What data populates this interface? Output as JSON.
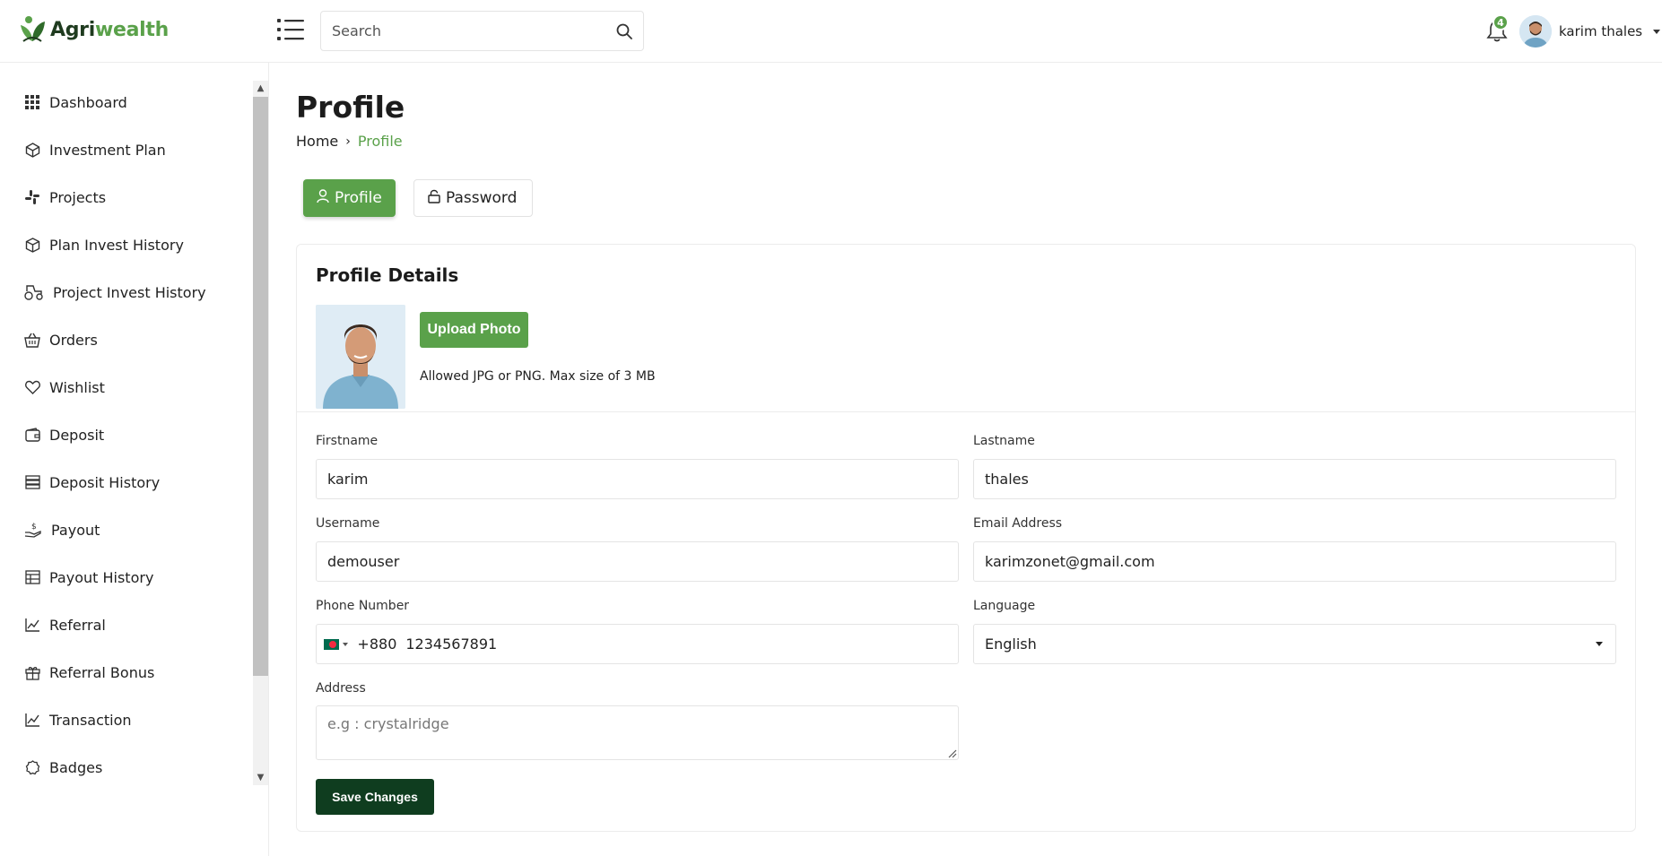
{
  "brand": {
    "logo_part1": "Agri",
    "logo_part2": "wealth",
    "primary_color": "#5aa14a",
    "dark_color": "#0f3d1f"
  },
  "header": {
    "search_placeholder": "Search",
    "notification_count": "4",
    "user_name": "karim thales"
  },
  "sidebar": {
    "items": [
      {
        "label": "Dashboard",
        "icon": "grid-icon"
      },
      {
        "label": "Investment Plan",
        "icon": "cube-3d-icon"
      },
      {
        "label": "Projects",
        "icon": "slack-icon"
      },
      {
        "label": "Plan Invest History",
        "icon": "box-icon"
      },
      {
        "label": "Project Invest History",
        "icon": "tractor-icon"
      },
      {
        "label": "Orders",
        "icon": "basket-icon"
      },
      {
        "label": "Wishlist",
        "icon": "heart-icon"
      },
      {
        "label": "Deposit",
        "icon": "wallet-icon"
      },
      {
        "label": "Deposit History",
        "icon": "server-icon"
      },
      {
        "label": "Payout",
        "icon": "hand-coin-icon"
      },
      {
        "label": "Payout History",
        "icon": "table-icon"
      },
      {
        "label": "Referral",
        "icon": "chart-line-icon"
      },
      {
        "label": "Referral Bonus",
        "icon": "gift-icon"
      },
      {
        "label": "Transaction",
        "icon": "chart-line-icon"
      },
      {
        "label": "Badges",
        "icon": "badge-icon"
      }
    ]
  },
  "page": {
    "title": "Profile",
    "breadcrumb_home": "Home",
    "breadcrumb_current": "Profile"
  },
  "tabs": {
    "profile": "Profile",
    "password": "Password"
  },
  "profile": {
    "card_title": "Profile Details",
    "upload_label": "Upload Photo",
    "upload_hint": "Allowed JPG or PNG. Max size of 3 MB",
    "firstname_label": "Firstname",
    "firstname_value": "karim",
    "lastname_label": "Lastname",
    "lastname_value": "thales",
    "username_label": "Username",
    "username_value": "demouser",
    "email_label": "Email Address",
    "email_value": "karimzonet@gmail.com",
    "phone_label": "Phone Number",
    "phone_code": "+880",
    "phone_value": "1234567891",
    "language_label": "Language",
    "language_value": "English",
    "address_label": "Address",
    "address_placeholder": "e.g : crystalridge",
    "save_label": "Save Changes"
  }
}
